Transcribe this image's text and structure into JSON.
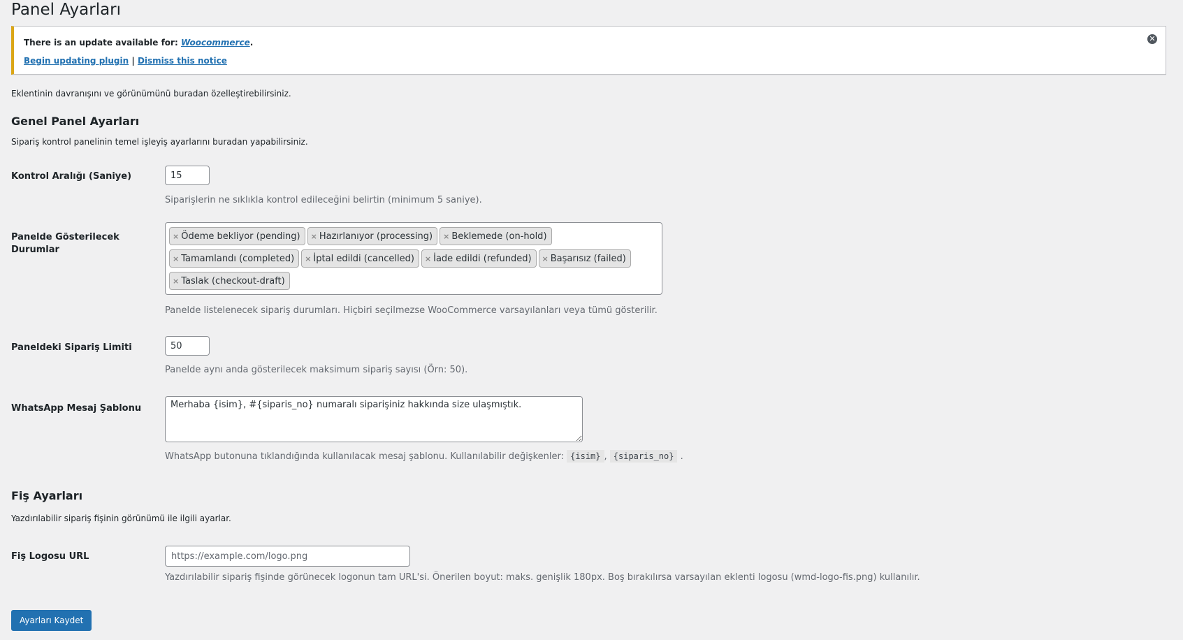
{
  "page": {
    "title": "Panel Ayarları",
    "intro": "Eklentinin davranışını ve görünümünü buradan özelleştirebilirsiniz."
  },
  "notice": {
    "prefix": "There is an update available for:",
    "plugin": "Woocommerce",
    "suffix": ".",
    "begin_link": "Begin updating plugin",
    "separator": "|",
    "dismiss_link": "Dismiss this notice",
    "close_glyph": "✕"
  },
  "general": {
    "heading": "Genel Panel Ayarları",
    "description": "Sipariş kontrol panelinin temel işleyiş ayarlarını buradan yapabilirsiniz.",
    "interval": {
      "label": "Kontrol Aralığı (Saniye)",
      "value": "15",
      "description": "Siparişlerin ne sıklıkla kontrol edileceğini belirtin (minimum 5 saniye)."
    },
    "statuses": {
      "label": "Panelde Gösterilecek Durumlar",
      "chips": [
        "Ödeme bekliyor (pending)",
        "Hazırlanıyor (processing)",
        "Beklemede (on-hold)",
        "Tamamlandı (completed)",
        "İptal edildi (cancelled)",
        "İade edildi (refunded)",
        "Başarısız (failed)",
        "Taslak (checkout-draft)"
      ],
      "remove_glyph": "×",
      "description": "Panelde listelenecek sipariş durumları. Hiçbiri seçilmezse WooCommerce varsayılanları veya tümü gösterilir."
    },
    "limit": {
      "label": "Paneldeki Sipariş Limiti",
      "value": "50",
      "description": "Panelde aynı anda gösterilecek maksimum sipariş sayısı (Örn: 50)."
    },
    "whatsapp": {
      "label": "WhatsApp Mesaj Şablonu",
      "value": "Merhaba {isim}, #{siparis_no} numaralı siparişiniz hakkında size ulaşmıştık.",
      "description_prefix": "WhatsApp butonuna tıklandığında kullanılacak mesaj şablonu. Kullanılabilir değişkenler:",
      "var1": "{isim}",
      "comma": ",",
      "var2": "{siparis_no}",
      "period": "."
    }
  },
  "receipt": {
    "heading": "Fiş Ayarları",
    "description": "Yazdırılabilir sipariş fişinin görünümü ile ilgili ayarlar.",
    "logo": {
      "label": "Fiş Logosu URL",
      "placeholder": "https://example.com/logo.png",
      "description": "Yazdırılabilir sipariş fişinde görünecek logonun tam URL'si. Önerilen boyut: maks. genişlik 180px. Boş bırakılırsa varsayılan eklenti logosu (wmd-logo-fis.png) kullanılır."
    }
  },
  "actions": {
    "save_label": "Ayarları Kaydet"
  },
  "colors": {
    "background": "#f0f0f1",
    "primary": "#2271b1",
    "notice_warning": "#dba617"
  }
}
